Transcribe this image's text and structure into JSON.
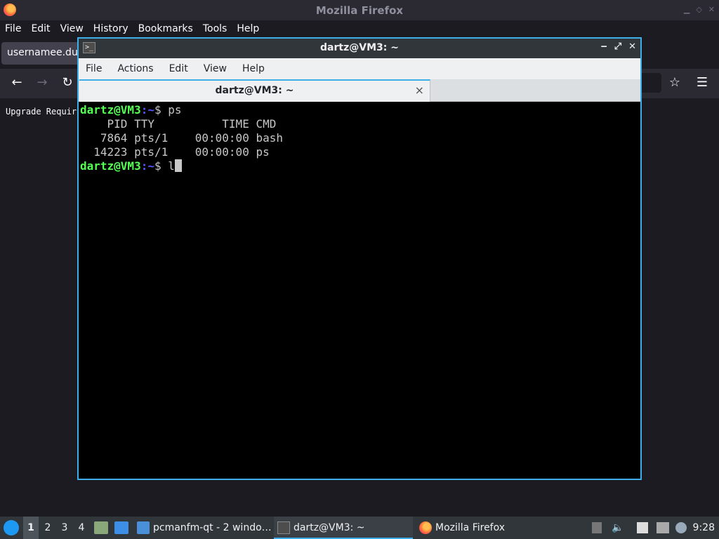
{
  "firefox": {
    "title": "Mozilla Firefox",
    "menu": [
      "File",
      "Edit",
      "View",
      "History",
      "Bookmarks",
      "Tools",
      "Help"
    ],
    "tab_label": "usernamee.duc",
    "content_text": "Upgrade Requir"
  },
  "terminal": {
    "title": "dartz@VM3: ~",
    "menu": [
      "File",
      "Actions",
      "Edit",
      "View",
      "Help"
    ],
    "tab_label": "dartz@VM3: ~",
    "tab_close": "×",
    "lines": [
      {
        "user": "dartz@VM3",
        "path": ":~",
        "cmd": "$ ps"
      },
      {
        "text": "    PID TTY          TIME CMD"
      },
      {
        "text": "   7864 pts/1    00:00:00 bash"
      },
      {
        "text": "  14223 pts/1    00:00:00 ps"
      },
      {
        "user": "dartz@VM3",
        "path": ":~",
        "cmd": "$ l"
      }
    ]
  },
  "taskbar": {
    "workspaces": [
      "1",
      "2",
      "3",
      "4"
    ],
    "tasks": [
      {
        "label": "pcmanfm-qt - 2 windo…"
      },
      {
        "label": "dartz@VM3: ~"
      },
      {
        "label": "Mozilla Firefox"
      }
    ],
    "clock": "9:28"
  },
  "colors": {
    "accent": "#3daee9",
    "prompt_user": "#54ff54",
    "prompt_path": "#5454ff"
  }
}
